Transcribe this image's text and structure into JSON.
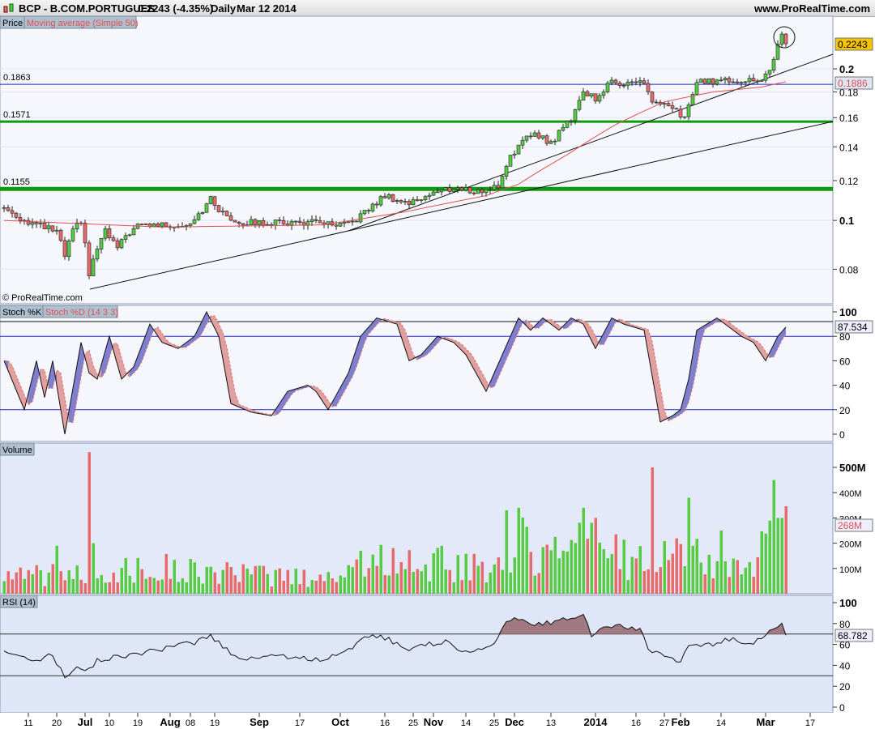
{
  "header": {
    "symbol": "BCP - B.COM.PORTUGUES",
    "price": "0.2243 (-4.35%)",
    "period": "Daily",
    "date": "Mar 12 2014",
    "site": "www.ProRealTime.com"
  },
  "watermark": "© ProRealTime.com",
  "colors": {
    "up": "#55cc44",
    "down": "#e86a6a",
    "ma": "#e05050",
    "level_green": "#119911",
    "level_blue": "#2222cc"
  },
  "chart_data": [
    {
      "type": "candlestick",
      "title": "Price",
      "legend": [
        "Price",
        "Moving average (Simple 50)"
      ],
      "scale": "log",
      "ylim": [
        0.068,
        0.245
      ],
      "yticks": [
        "0.08",
        "0.1",
        "0.12",
        "0.14",
        "0.16",
        "0.18",
        "0.2"
      ],
      "last_price": "0.2243",
      "ma_last": "0.1886",
      "levels": [
        {
          "label": "0.1863",
          "value": 0.1863
        },
        {
          "label": "0.1571",
          "value": 0.1571
        },
        {
          "label": "0.1155",
          "value": 0.1155
        }
      ],
      "bars": 194,
      "close_keypoints": [
        [
          0,
          0.106
        ],
        [
          5,
          0.1
        ],
        [
          8,
          0.098
        ],
        [
          13,
          0.095
        ],
        [
          15,
          0.085
        ],
        [
          17,
          0.095
        ],
        [
          19,
          0.1
        ],
        [
          21,
          0.078
        ],
        [
          23,
          0.088
        ],
        [
          25,
          0.095
        ],
        [
          28,
          0.088
        ],
        [
          31,
          0.095
        ],
        [
          34,
          0.098
        ],
        [
          45,
          0.098
        ],
        [
          49,
          0.105
        ],
        [
          51,
          0.11
        ],
        [
          54,
          0.103
        ],
        [
          57,
          0.1
        ],
        [
          59,
          0.099
        ],
        [
          79,
          0.099
        ],
        [
          81,
          0.097
        ],
        [
          85,
          0.098
        ],
        [
          90,
          0.105
        ],
        [
          94,
          0.112
        ],
        [
          100,
          0.108
        ],
        [
          105,
          0.113
        ],
        [
          111,
          0.116
        ],
        [
          117,
          0.114
        ],
        [
          122,
          0.117
        ],
        [
          125,
          0.135
        ],
        [
          131,
          0.15
        ],
        [
          135,
          0.142
        ],
        [
          140,
          0.16
        ],
        [
          143,
          0.18
        ],
        [
          146,
          0.175
        ],
        [
          150,
          0.188
        ],
        [
          158,
          0.188
        ],
        [
          160,
          0.172
        ],
        [
          165,
          0.166
        ],
        [
          168,
          0.16
        ],
        [
          171,
          0.188
        ],
        [
          177,
          0.19
        ],
        [
          185,
          0.19
        ],
        [
          187,
          0.188
        ],
        [
          189,
          0.2
        ],
        [
          191,
          0.222
        ],
        [
          192,
          0.2345
        ],
        [
          193,
          0.2243
        ]
      ],
      "ma_keypoints": [
        [
          0,
          0.1
        ],
        [
          39,
          0.097
        ],
        [
          79,
          0.098
        ],
        [
          99,
          0.104
        ],
        [
          119,
          0.112
        ],
        [
          127,
          0.118
        ],
        [
          139,
          0.135
        ],
        [
          151,
          0.155
        ],
        [
          163,
          0.172
        ],
        [
          175,
          0.18
        ],
        [
          187,
          0.184
        ],
        [
          193,
          0.1886
        ]
      ],
      "x_ticks": [
        {
          "label": "11",
          "bar": 6
        },
        {
          "label": "20",
          "bar": 3,
          "skip": true
        },
        {
          "label": "20",
          "bar": 13
        },
        {
          "label": "Jul",
          "bar": 20,
          "bold": true
        },
        {
          "label": "10",
          "bar": 26
        },
        {
          "label": "19",
          "bar": 33
        },
        {
          "label": "Aug",
          "bar": 41,
          "bold": true
        },
        {
          "label": "08",
          "bar": 46
        },
        {
          "label": "19",
          "bar": 52
        },
        {
          "label": "Sep",
          "bar": 63,
          "bold": true
        },
        {
          "label": "17",
          "bar": 73
        },
        {
          "label": "Oct",
          "bar": 83,
          "bold": true
        },
        {
          "label": "16",
          "bar": 94
        },
        {
          "label": "25",
          "bar": 101
        },
        {
          "label": "Nov",
          "bar": 106,
          "bold": true
        },
        {
          "label": "14",
          "bar": 114
        },
        {
          "label": "25",
          "bar": 121
        },
        {
          "label": "Dec",
          "bar": 126,
          "bold": true
        },
        {
          "label": "13",
          "bar": 135
        },
        {
          "label": "2014",
          "bar": 146,
          "bold": true
        },
        {
          "label": "16",
          "bar": 156
        },
        {
          "label": "27",
          "bar": 163
        },
        {
          "label": "Feb",
          "bar": 167,
          "bold": true
        },
        {
          "label": "14",
          "bar": 177
        },
        {
          "label": "Mar",
          "bar": 188,
          "bold": true
        },
        {
          "label": "17",
          "bar": 199
        }
      ]
    },
    {
      "type": "line",
      "title": "Stoch %K",
      "legend": [
        "Stoch %K",
        "Stoch %D (14 3 3)"
      ],
      "ylim": [
        0,
        100
      ],
      "yticks": [
        "0",
        "20",
        "40",
        "60",
        "80",
        "100"
      ],
      "levels": [
        20,
        80
      ],
      "last_value": "87.534",
      "k_keypoints": [
        [
          0,
          60
        ],
        [
          5,
          20
        ],
        [
          8,
          60
        ],
        [
          10,
          30
        ],
        [
          12,
          60
        ],
        [
          15,
          0
        ],
        [
          19,
          75
        ],
        [
          21,
          50
        ],
        [
          23,
          45
        ],
        [
          26,
          80
        ],
        [
          29,
          45
        ],
        [
          32,
          55
        ],
        [
          36,
          90
        ],
        [
          39,
          75
        ],
        [
          43,
          70
        ],
        [
          47,
          80
        ],
        [
          50,
          100
        ],
        [
          53,
          80
        ],
        [
          56,
          25
        ],
        [
          61,
          18
        ],
        [
          66,
          15
        ],
        [
          70,
          35
        ],
        [
          75,
          40
        ],
        [
          77,
          35
        ],
        [
          80,
          20
        ],
        [
          85,
          50
        ],
        [
          88,
          80
        ],
        [
          92,
          95
        ],
        [
          97,
          90
        ],
        [
          100,
          60
        ],
        [
          103,
          65
        ],
        [
          107,
          80
        ],
        [
          111,
          75
        ],
        [
          114,
          65
        ],
        [
          119,
          35
        ],
        [
          123,
          65
        ],
        [
          127,
          95
        ],
        [
          130,
          85
        ],
        [
          133,
          95
        ],
        [
          137,
          85
        ],
        [
          140,
          95
        ],
        [
          143,
          90
        ],
        [
          146,
          70
        ],
        [
          150,
          95
        ],
        [
          153,
          90
        ],
        [
          158,
          85
        ],
        [
          162,
          10
        ],
        [
          165,
          15
        ],
        [
          167,
          20
        ],
        [
          169,
          45
        ],
        [
          171,
          85
        ],
        [
          176,
          95
        ],
        [
          182,
          80
        ],
        [
          185,
          75
        ],
        [
          188,
          60
        ],
        [
          191,
          80
        ],
        [
          193,
          87.5
        ]
      ]
    },
    {
      "type": "bar",
      "title": "Volume",
      "ylim": [
        0,
        600000000
      ],
      "yticks": [
        "100M",
        "200M",
        "300M",
        "400M",
        "500M"
      ],
      "last_value": "268M",
      "base_keypoints": [
        [
          0,
          70
        ],
        [
          20,
          90
        ],
        [
          40,
          110
        ],
        [
          60,
          80
        ],
        [
          80,
          70
        ],
        [
          90,
          150
        ],
        [
          100,
          140
        ],
        [
          110,
          130
        ],
        [
          120,
          110
        ],
        [
          125,
          220
        ],
        [
          135,
          190
        ],
        [
          145,
          200
        ],
        [
          155,
          150
        ],
        [
          165,
          180
        ],
        [
          175,
          130
        ],
        [
          185,
          120
        ],
        [
          190,
          280
        ],
        [
          193,
          268
        ]
      ],
      "spikes": [
        [
          21,
          560
        ],
        [
          22,
          200
        ],
        [
          13,
          190
        ],
        [
          124,
          330
        ],
        [
          127,
          340
        ],
        [
          143,
          340
        ],
        [
          146,
          300
        ],
        [
          160,
          500
        ],
        [
          169,
          380
        ],
        [
          177,
          250
        ],
        [
          190,
          450
        ],
        [
          191,
          300
        ],
        [
          192,
          300
        ]
      ]
    },
    {
      "type": "area",
      "title": "RSI (14)",
      "ylim": [
        0,
        100
      ],
      "yticks": [
        "0",
        "20",
        "40",
        "60",
        "80",
        "100"
      ],
      "levels": [
        30,
        70
      ],
      "last_value": "68.782",
      "keypoints": [
        [
          0,
          55
        ],
        [
          4,
          50
        ],
        [
          8,
          45
        ],
        [
          12,
          50
        ],
        [
          15,
          28
        ],
        [
          18,
          40
        ],
        [
          21,
          35
        ],
        [
          23,
          45
        ],
        [
          31,
          50
        ],
        [
          39,
          55
        ],
        [
          47,
          62
        ],
        [
          51,
          68
        ],
        [
          55,
          55
        ],
        [
          59,
          45
        ],
        [
          65,
          50
        ],
        [
          79,
          45
        ],
        [
          87,
          60
        ],
        [
          91,
          70
        ],
        [
          95,
          65
        ],
        [
          99,
          55
        ],
        [
          103,
          60
        ],
        [
          109,
          62
        ],
        [
          115,
          52
        ],
        [
          121,
          60
        ],
        [
          124,
          80
        ],
        [
          127,
          85
        ],
        [
          131,
          78
        ],
        [
          139,
          85
        ],
        [
          143,
          90
        ],
        [
          145,
          68
        ],
        [
          149,
          78
        ],
        [
          157,
          75
        ],
        [
          159,
          55
        ],
        [
          163,
          50
        ],
        [
          167,
          43
        ],
        [
          169,
          58
        ],
        [
          175,
          60
        ],
        [
          179,
          65
        ],
        [
          185,
          62
        ],
        [
          188,
          70
        ],
        [
          192,
          78
        ],
        [
          193,
          68.8
        ]
      ]
    }
  ]
}
